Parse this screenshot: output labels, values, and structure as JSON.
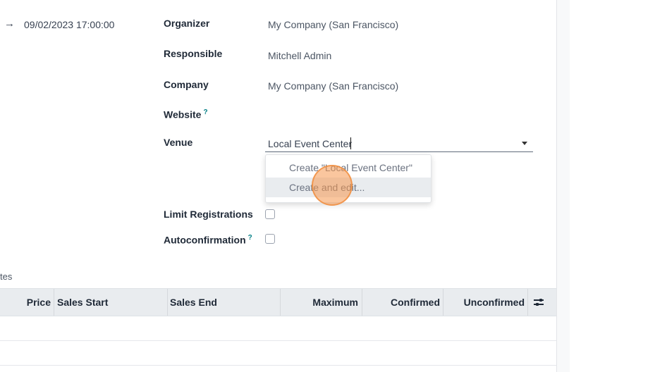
{
  "event": {
    "date_arrow": "→",
    "end_date": "09/02/2023 17:00:00"
  },
  "fields": {
    "organizer": {
      "label": "Organizer",
      "value": "My Company (San Francisco)"
    },
    "responsible": {
      "label": "Responsible",
      "value": "Mitchell Admin"
    },
    "company": {
      "label": "Company",
      "value": "My Company (San Francisco)"
    },
    "website": {
      "label": "Website",
      "help": "?"
    },
    "venue": {
      "label": "Venue",
      "value": "Local Event Center"
    },
    "limit_registrations": {
      "label": "Limit Registrations",
      "checked": false
    },
    "autoconfirmation": {
      "label": "Autoconfirmation",
      "help": "?",
      "checked": false
    }
  },
  "venue_dropdown": {
    "items": [
      "Create \"Local Event Center\"",
      "Create and edit..."
    ],
    "hovered_index": 1
  },
  "tab_partial": "tes",
  "tickets_table": {
    "columns": [
      "Price",
      "Sales Start",
      "Sales End",
      "Maximum",
      "Confirmed",
      "Unconfirmed"
    ],
    "optional_columns_icon": "sliders-icon"
  },
  "colors": {
    "accent_help": "#017e84",
    "click_indicator": "#f5984f",
    "table_header_bg": "#e9ecef"
  }
}
